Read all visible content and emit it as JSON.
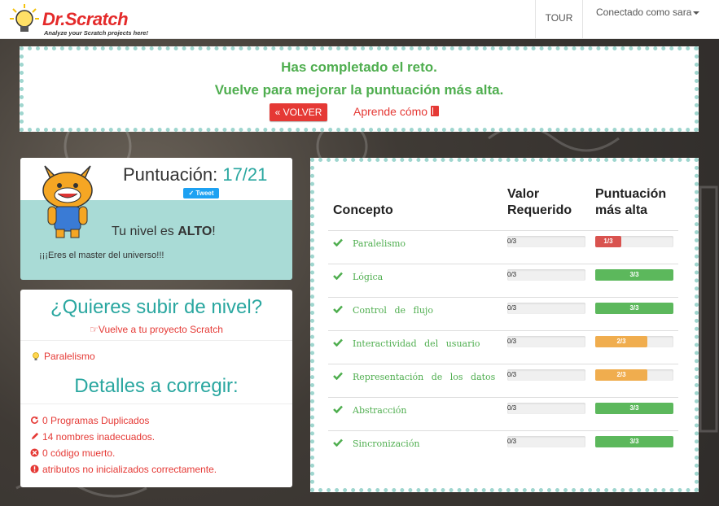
{
  "navbar": {
    "logo_title": "Dr.Scratch",
    "logo_subtitle": "Analyze your Scratch projects here!",
    "tour_label": "TOUR",
    "user_label": "Conectado como sara"
  },
  "banner": {
    "line1": "Has completado el reto.",
    "line2": "Vuelve para mejorar la puntuación más alta.",
    "back_button": "« VOLVER",
    "learn_link": "Aprende cómo"
  },
  "score": {
    "title": "Puntuación:",
    "value": "17/21",
    "tweet": "Tweet",
    "level_prefix": "Tu nivel es ",
    "level_value": "ALTO",
    "level_suffix": "!",
    "master_text": "¡¡¡Eres el master del universo!!!"
  },
  "level_up": {
    "title": "¿Quieres subir de nivel?",
    "link": "Vuelve a tu proyecto Scratch",
    "concept": "Paralelismo",
    "details_title": "Detalles a corregir:",
    "issues": [
      {
        "icon": "refresh-icon",
        "text": "0 Programas Duplicados"
      },
      {
        "icon": "pencil-icon",
        "text": "14 nombres inadecuados."
      },
      {
        "icon": "dead-code-icon",
        "text": "0 código muerto."
      },
      {
        "icon": "warning-icon",
        "text": "atributos no inicializados correctamente."
      }
    ]
  },
  "concepts": {
    "headers": {
      "concept": "Concepto",
      "required_1": "Valor",
      "required_2": "Requerido",
      "best_1": "Puntuación",
      "best_2": "más alta"
    },
    "rows": [
      {
        "name": "Paralelismo",
        "required": "0/3",
        "best": "1/3",
        "best_fraction": 0.333,
        "color": "#d9534f"
      },
      {
        "name": "Lógica",
        "required": "0/3",
        "best": "3/3",
        "best_fraction": 1.0,
        "color": "#5cb85c"
      },
      {
        "name": "Control de flujo",
        "required": "0/3",
        "best": "3/3",
        "best_fraction": 1.0,
        "color": "#5cb85c"
      },
      {
        "name": "Interactividad del usuario",
        "required": "0/3",
        "best": "2/3",
        "best_fraction": 0.667,
        "color": "#f0ad4e"
      },
      {
        "name": "Representación de los datos",
        "required": "0/3",
        "best": "2/3",
        "best_fraction": 0.667,
        "color": "#f0ad4e"
      },
      {
        "name": "Abstracción",
        "required": "0/3",
        "best": "3/3",
        "best_fraction": 1.0,
        "color": "#5cb85c"
      },
      {
        "name": "Sincronización",
        "required": "0/3",
        "best": "3/3",
        "best_fraction": 1.0,
        "color": "#5cb85c"
      }
    ]
  },
  "colors": {
    "teal": "#2aa7a0",
    "green": "#4fae4f",
    "red": "#e53935",
    "border_dots": "#9fd6cf"
  }
}
